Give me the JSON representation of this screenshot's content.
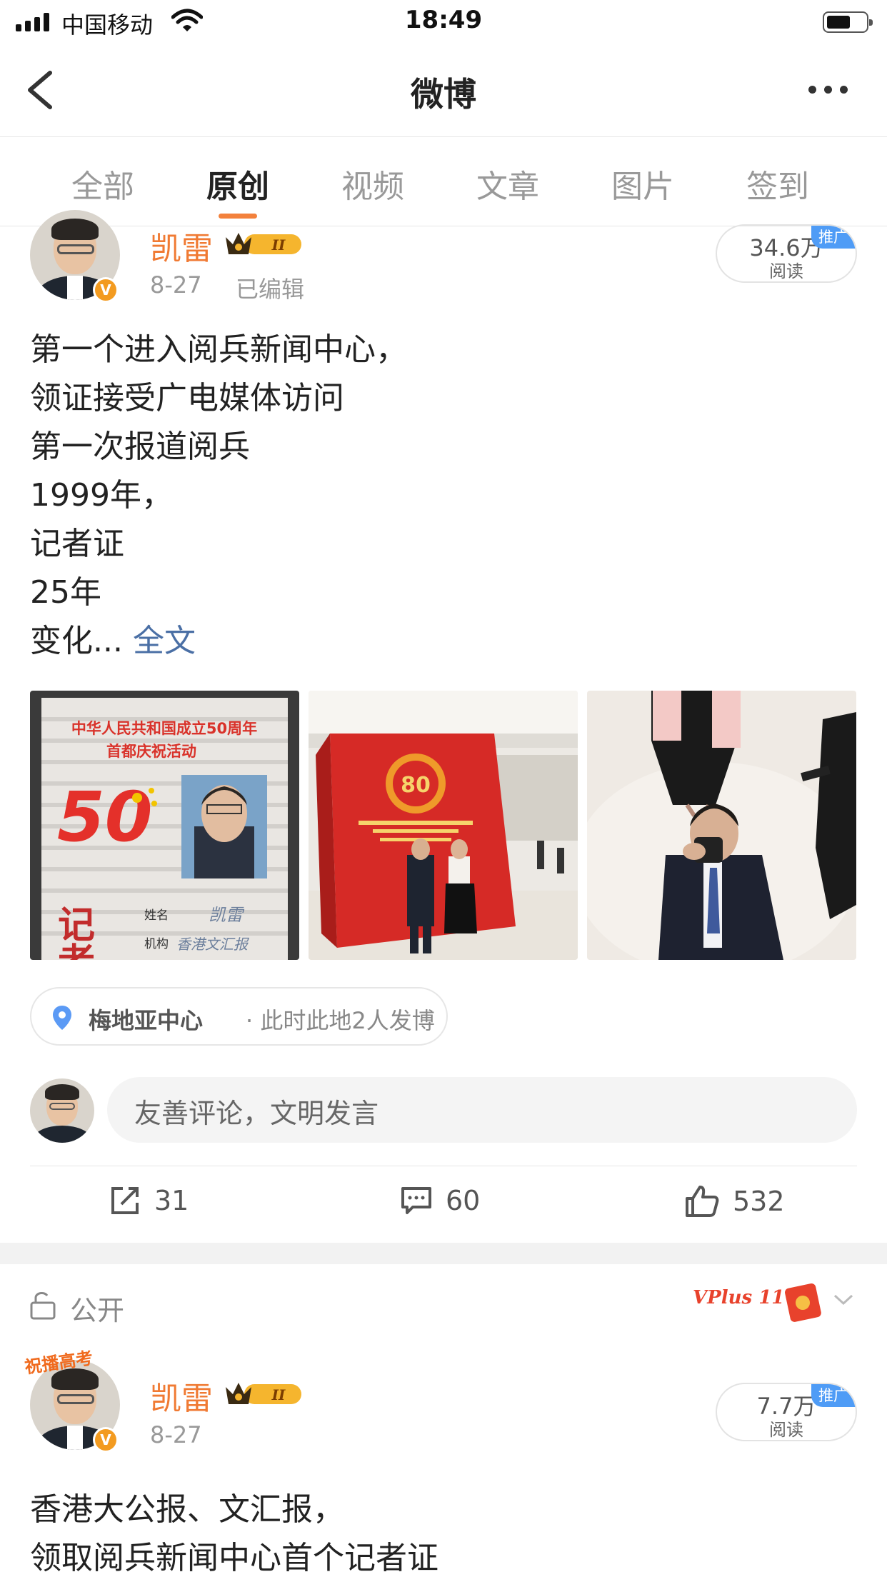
{
  "status_bar": {
    "carrier": "中国移动",
    "time": "18:49"
  },
  "nav": {
    "title": "微博"
  },
  "tabs": [
    {
      "label": "全部",
      "active": false
    },
    {
      "label": "原创",
      "active": true
    },
    {
      "label": "视频",
      "active": false
    },
    {
      "label": "文章",
      "active": false
    },
    {
      "label": "图片",
      "active": false
    },
    {
      "label": "签到",
      "active": false
    }
  ],
  "post1": {
    "username": "凯雷",
    "level_badge": "II",
    "date": "8-27",
    "edited": "已编辑",
    "reads": "34.6万",
    "reads_unit": "阅读",
    "promo_label": "推广",
    "lines": [
      "第一个进入阅兵新闻中心，",
      "领证接受广电媒体访问",
      "第一次报道阅兵",
      "1999年，",
      "记者证",
      "25年"
    ],
    "last_line": "变化...",
    "full_text_link": "全文",
    "photo1": {
      "title_line1": "中华人民共和国成立50周年",
      "title_line2": "首都庆祝活动",
      "big_number": "50",
      "card_type": "记者",
      "field_name": "姓名",
      "field_org": "机构",
      "signature": "凯雷",
      "org_handwriting": "香港文汇报"
    },
    "photo2": {
      "emblem_number": "80"
    },
    "location": {
      "place": "梅地亚中心",
      "count": "· 此时此地2人发博"
    },
    "comment_placeholder": "友善评论，文明发言",
    "actions": {
      "reposts": "31",
      "comments": "60",
      "likes": "532"
    }
  },
  "visibility": {
    "label": "公开",
    "promo_text": "VPlus 11·11"
  },
  "post2": {
    "avatar_banner": "祝播高考",
    "username": "凯雷",
    "level_badge": "II",
    "date": "8-27",
    "reads": "7.7万",
    "reads_unit": "阅读",
    "promo_label": "推广",
    "lines": [
      "香港大公报、文汇报，",
      "领取阅兵新闻中心首个记者证"
    ]
  },
  "colors": {
    "accent_orange": "#f3813c",
    "username_orange": "#f07a33",
    "link_blue": "#4a6fa5",
    "promo_blue": "#4f9cf6"
  }
}
